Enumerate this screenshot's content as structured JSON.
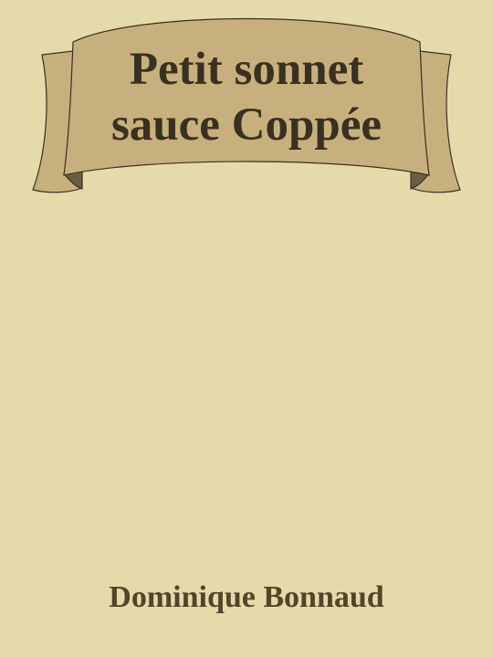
{
  "cover": {
    "title_line1": "Petit sonnet",
    "title_line2": "sauce Coppée",
    "author": "Dominique Bonnaud"
  },
  "colors": {
    "background": "#e5daa9",
    "banner_fill": "#c8b07e",
    "banner_fold": "#6b5e45",
    "banner_outline": "#3a3020",
    "title_text": "#3a3020",
    "author_text": "#554429"
  }
}
